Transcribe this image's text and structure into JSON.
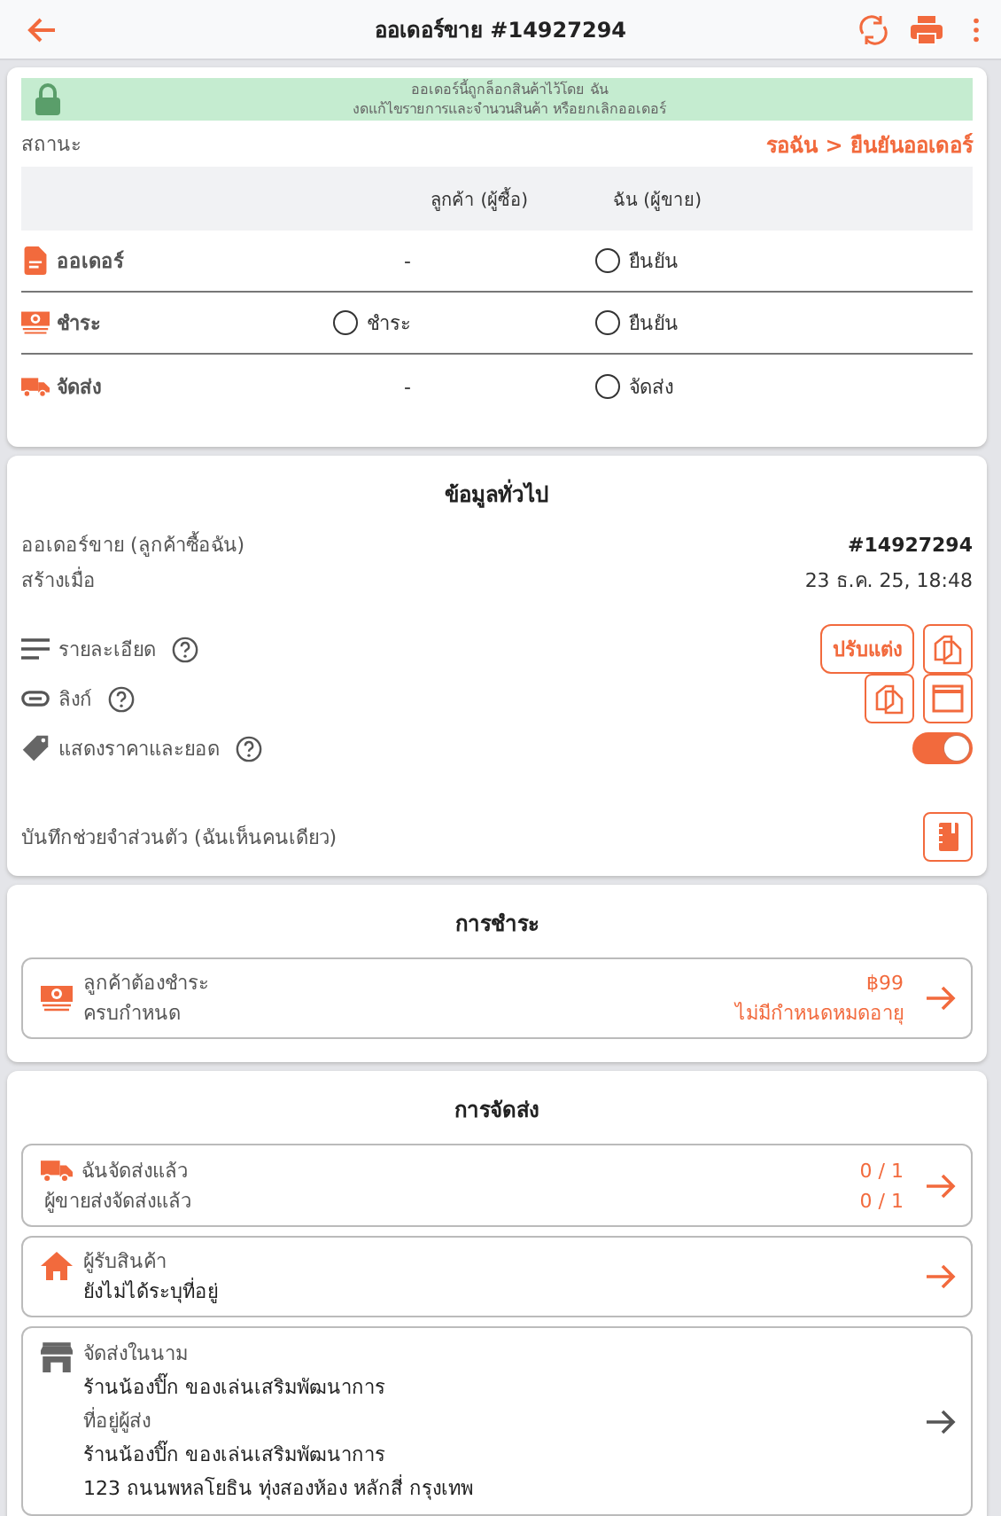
{
  "header": {
    "title": "ออเดอร์ขาย #14927294"
  },
  "lock_banner": {
    "lines": [
      "ออเดอร์นี้ถูกล็อกสินค้าไว้โดย ฉัน",
      "งดแก้ไขรายการและจำนวนสินค้า หรือยกเลิกออเดอร์"
    ]
  },
  "status": {
    "label": "สถานะ",
    "value": "รอฉัน > ยืนยันออเดอร์"
  },
  "status_table": {
    "columns": [
      "ลูกค้า (ผู้ซื้อ)",
      "ฉัน (ผู้ขาย)"
    ],
    "rows": [
      {
        "kind": "order",
        "label": "ออเดอร์",
        "buyer": {
          "kind": "text",
          "text": "-"
        },
        "seller": {
          "kind": "radio",
          "text": "ยืนยัน",
          "checked": false
        }
      },
      {
        "kind": "payment",
        "label": "ชำระ",
        "buyer": {
          "kind": "radio",
          "text": "ชำระ",
          "checked": false
        },
        "seller": {
          "kind": "radio",
          "text": "ยืนยัน",
          "checked": false
        }
      },
      {
        "kind": "shipping",
        "label": "จัดส่ง",
        "buyer": {
          "kind": "text",
          "text": "-"
        },
        "seller": {
          "kind": "radio",
          "text": "จัดส่ง",
          "checked": false
        }
      }
    ]
  },
  "general": {
    "title": "ข้อมูลทั่วไป",
    "rows": [
      {
        "label": "ออเดอร์ขาย (ลูกค้าซื้อฉัน)",
        "value": "#14927294",
        "bold": true
      },
      {
        "label": "สร้างเมื่อ",
        "value": "23 ธ.ค. 25, 18:48",
        "bold": false
      }
    ],
    "details": {
      "label": "รายละเอียด",
      "edit_button": "ปรับแต่ง"
    },
    "link": {
      "label": "ลิงก์"
    },
    "show_price": {
      "label": "แสดงราคาและยอด",
      "on": true
    },
    "note": {
      "label": "บันทึกช่วยจำส่วนตัว (ฉันเห็นคนเดียว)"
    }
  },
  "payment": {
    "title": "การชำระ",
    "label": "ลูกค้าต้องชำระ",
    "sublabel": "ครบกำหนด",
    "amount": "฿99",
    "expiry": "ไม่มีกำหนดหมดอายุ"
  },
  "shipping": {
    "title": "การจัดส่ง",
    "shipped": {
      "label": "ฉันจัดส่งแล้ว",
      "sublabel": "ผู้ขายส่งจัดส่งแล้ว",
      "counts": [
        "0 / 1",
        "0 / 1"
      ]
    },
    "recipient": {
      "label": "ผู้รับสินค้า",
      "value": "ยังไม่ได้ระบุที่อยู่"
    },
    "sender": {
      "label": "จัดส่งในนาม",
      "name": "ร้านน้องปิ๊ก ของเล่นเสริมพัฒนาการ",
      "address_label": "ที่อยู่ผู้ส่ง",
      "address_name": "ร้านน้องปิ๊ก ของเล่นเสริมพัฒนาการ",
      "address_line": "123 ถนนพหลโยธิน ทุ่งสองห้อง หลักสี่ กรุงเทพ"
    }
  }
}
